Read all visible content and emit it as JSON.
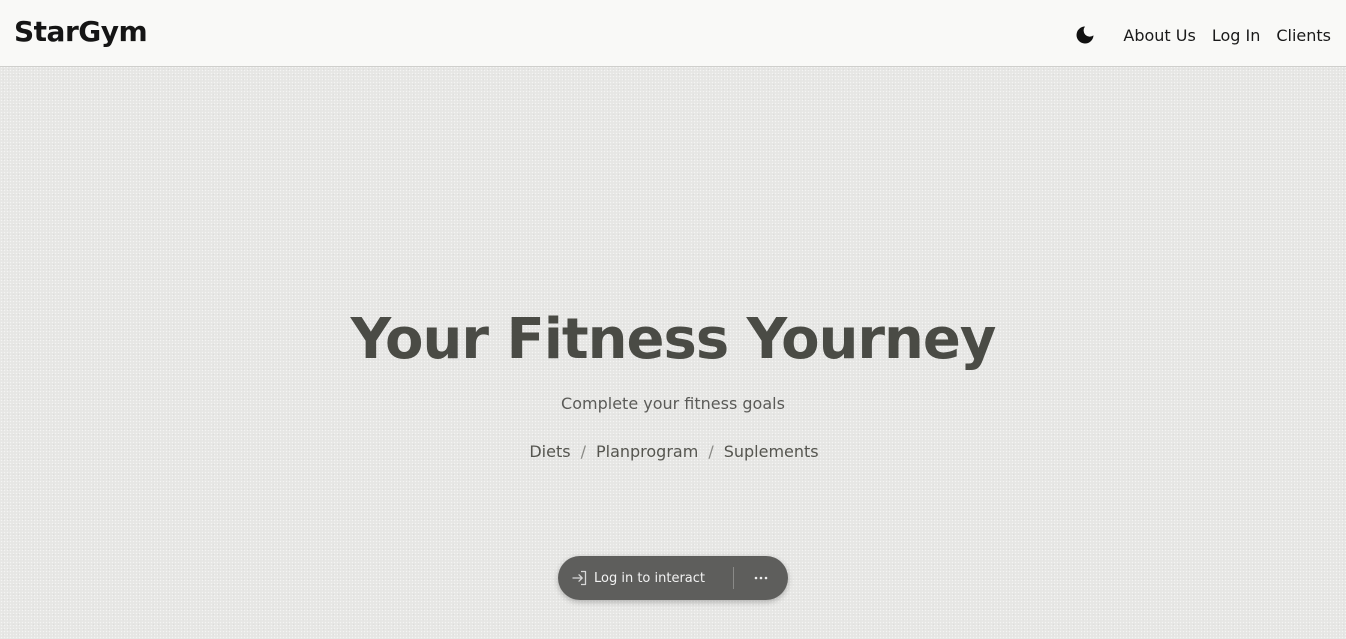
{
  "header": {
    "logo": "StarGym",
    "theme_toggle_icon": "moon-icon",
    "nav": [
      {
        "label": "About Us"
      },
      {
        "label": "Log In"
      },
      {
        "label": "Clients"
      }
    ]
  },
  "hero": {
    "title": "Your Fitness Yourney",
    "subtitle": "Complete your fitness goals",
    "links": [
      {
        "label": "Diets"
      },
      {
        "label": "Planprogram"
      },
      {
        "label": "Suplements"
      }
    ],
    "separator": "/"
  },
  "interact_bar": {
    "icon": "login-arrow-icon",
    "label": "Log in to interact",
    "more_icon": "more-dots-icon"
  },
  "colors": {
    "background": "#e6e6e4",
    "header_background": "#f9f9f7",
    "title": "#4a4b45",
    "pill_background": "#5e5e5c"
  }
}
